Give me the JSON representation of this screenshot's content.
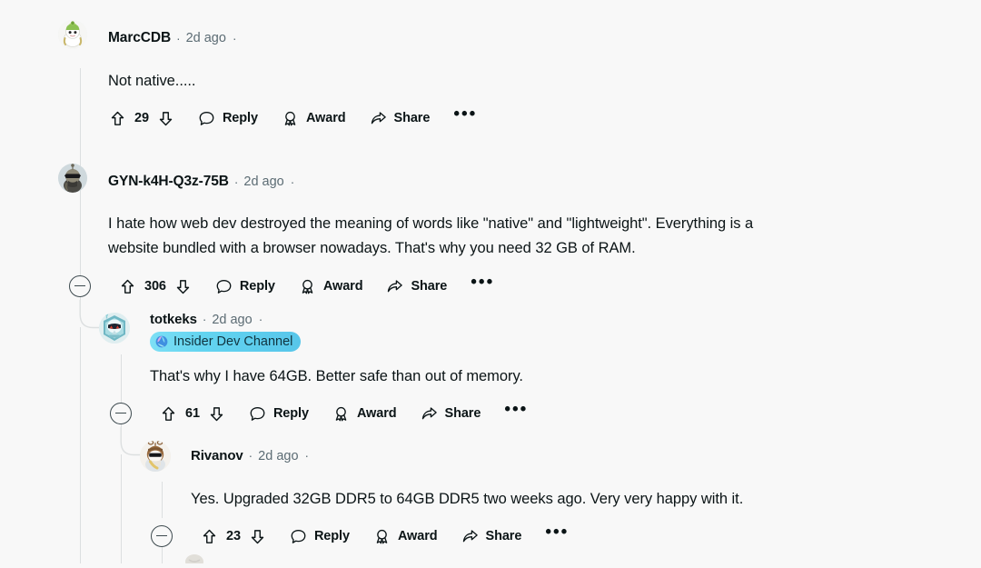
{
  "page": {
    "background": "#f8f8f8",
    "text_color": "#0b1416",
    "muted_color": "#5c6c74",
    "thread_line_color": "#dcdfe0"
  },
  "actions_labels": {
    "reply": "Reply",
    "award": "Award",
    "share": "Share",
    "more": "•••"
  },
  "icons": {
    "upvote": "upvote-arrow-icon",
    "downvote": "downvote-arrow-icon",
    "reply": "speech-bubble-icon",
    "award": "award-medal-icon",
    "share": "share-arrow-icon",
    "more": "more-options-icon",
    "collapse": "collapse-minus-icon",
    "flair": "insider-globe-icon"
  },
  "comments": [
    {
      "id": "c1",
      "author": "MarcCDB",
      "timestamp": "2d ago",
      "separator": "·",
      "body": "Not native.....",
      "votes": "29",
      "depth": 0,
      "flair": null,
      "avatar": "snoo-green-hat-avatar"
    },
    {
      "id": "c2",
      "author": "GYN-k4H-Q3z-75B",
      "timestamp": "2d ago",
      "separator": "·",
      "body_line1": "I hate how web dev destroyed the meaning of words like \"native\" and \"lightweight\". Everything is a",
      "body_line2": "website bundled with a browser nowadays. That's why you need 32 GB of RAM.",
      "votes": "306",
      "depth": 0,
      "flair": null,
      "avatar": "snoo-sunglasses-avatar"
    },
    {
      "id": "c3",
      "author": "totkeks",
      "timestamp": "2d ago",
      "separator": "·",
      "body": "That's why I have 64GB. Better safe than out of memory.",
      "votes": "61",
      "depth": 1,
      "flair": {
        "label": "Insider Dev Channel",
        "background": "#63d4f0",
        "text_color": "#10343f"
      },
      "avatar": "snoo-teal-armor-avatar"
    },
    {
      "id": "c4",
      "author": "Rivanov",
      "timestamp": "2d ago",
      "separator": "·",
      "body": "Yes. Upgraded 32GB DDR5 to 64GB DDR5 two weeks ago. Very very happy with it.",
      "votes": "23",
      "depth": 2,
      "flair": null,
      "avatar": "snoo-brown-sunglasses-avatar"
    }
  ]
}
